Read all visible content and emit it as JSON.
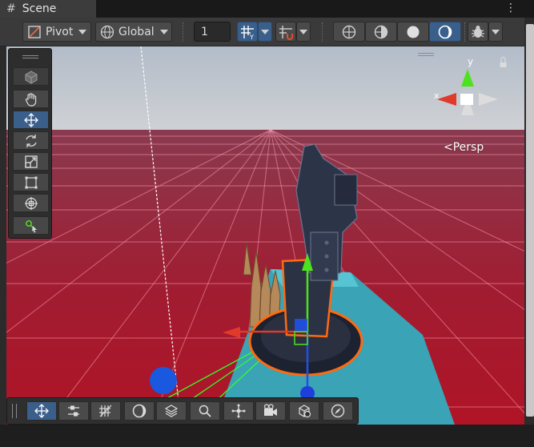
{
  "tab": {
    "title": "Scene"
  },
  "toolbar": {
    "pivot_label": "Pivot",
    "global_label": "Global",
    "grid_value": "1"
  },
  "viewport": {
    "projection_label": "Persp",
    "axis_x": "x",
    "axis_y": "y"
  },
  "colors": {
    "accent": "#3a5f8a",
    "x_axis": "#e03a2a",
    "y_axis": "#4ee21e",
    "z_axis": "#2050e8",
    "selection": "#ff6a10",
    "floor": "#a11c31"
  }
}
